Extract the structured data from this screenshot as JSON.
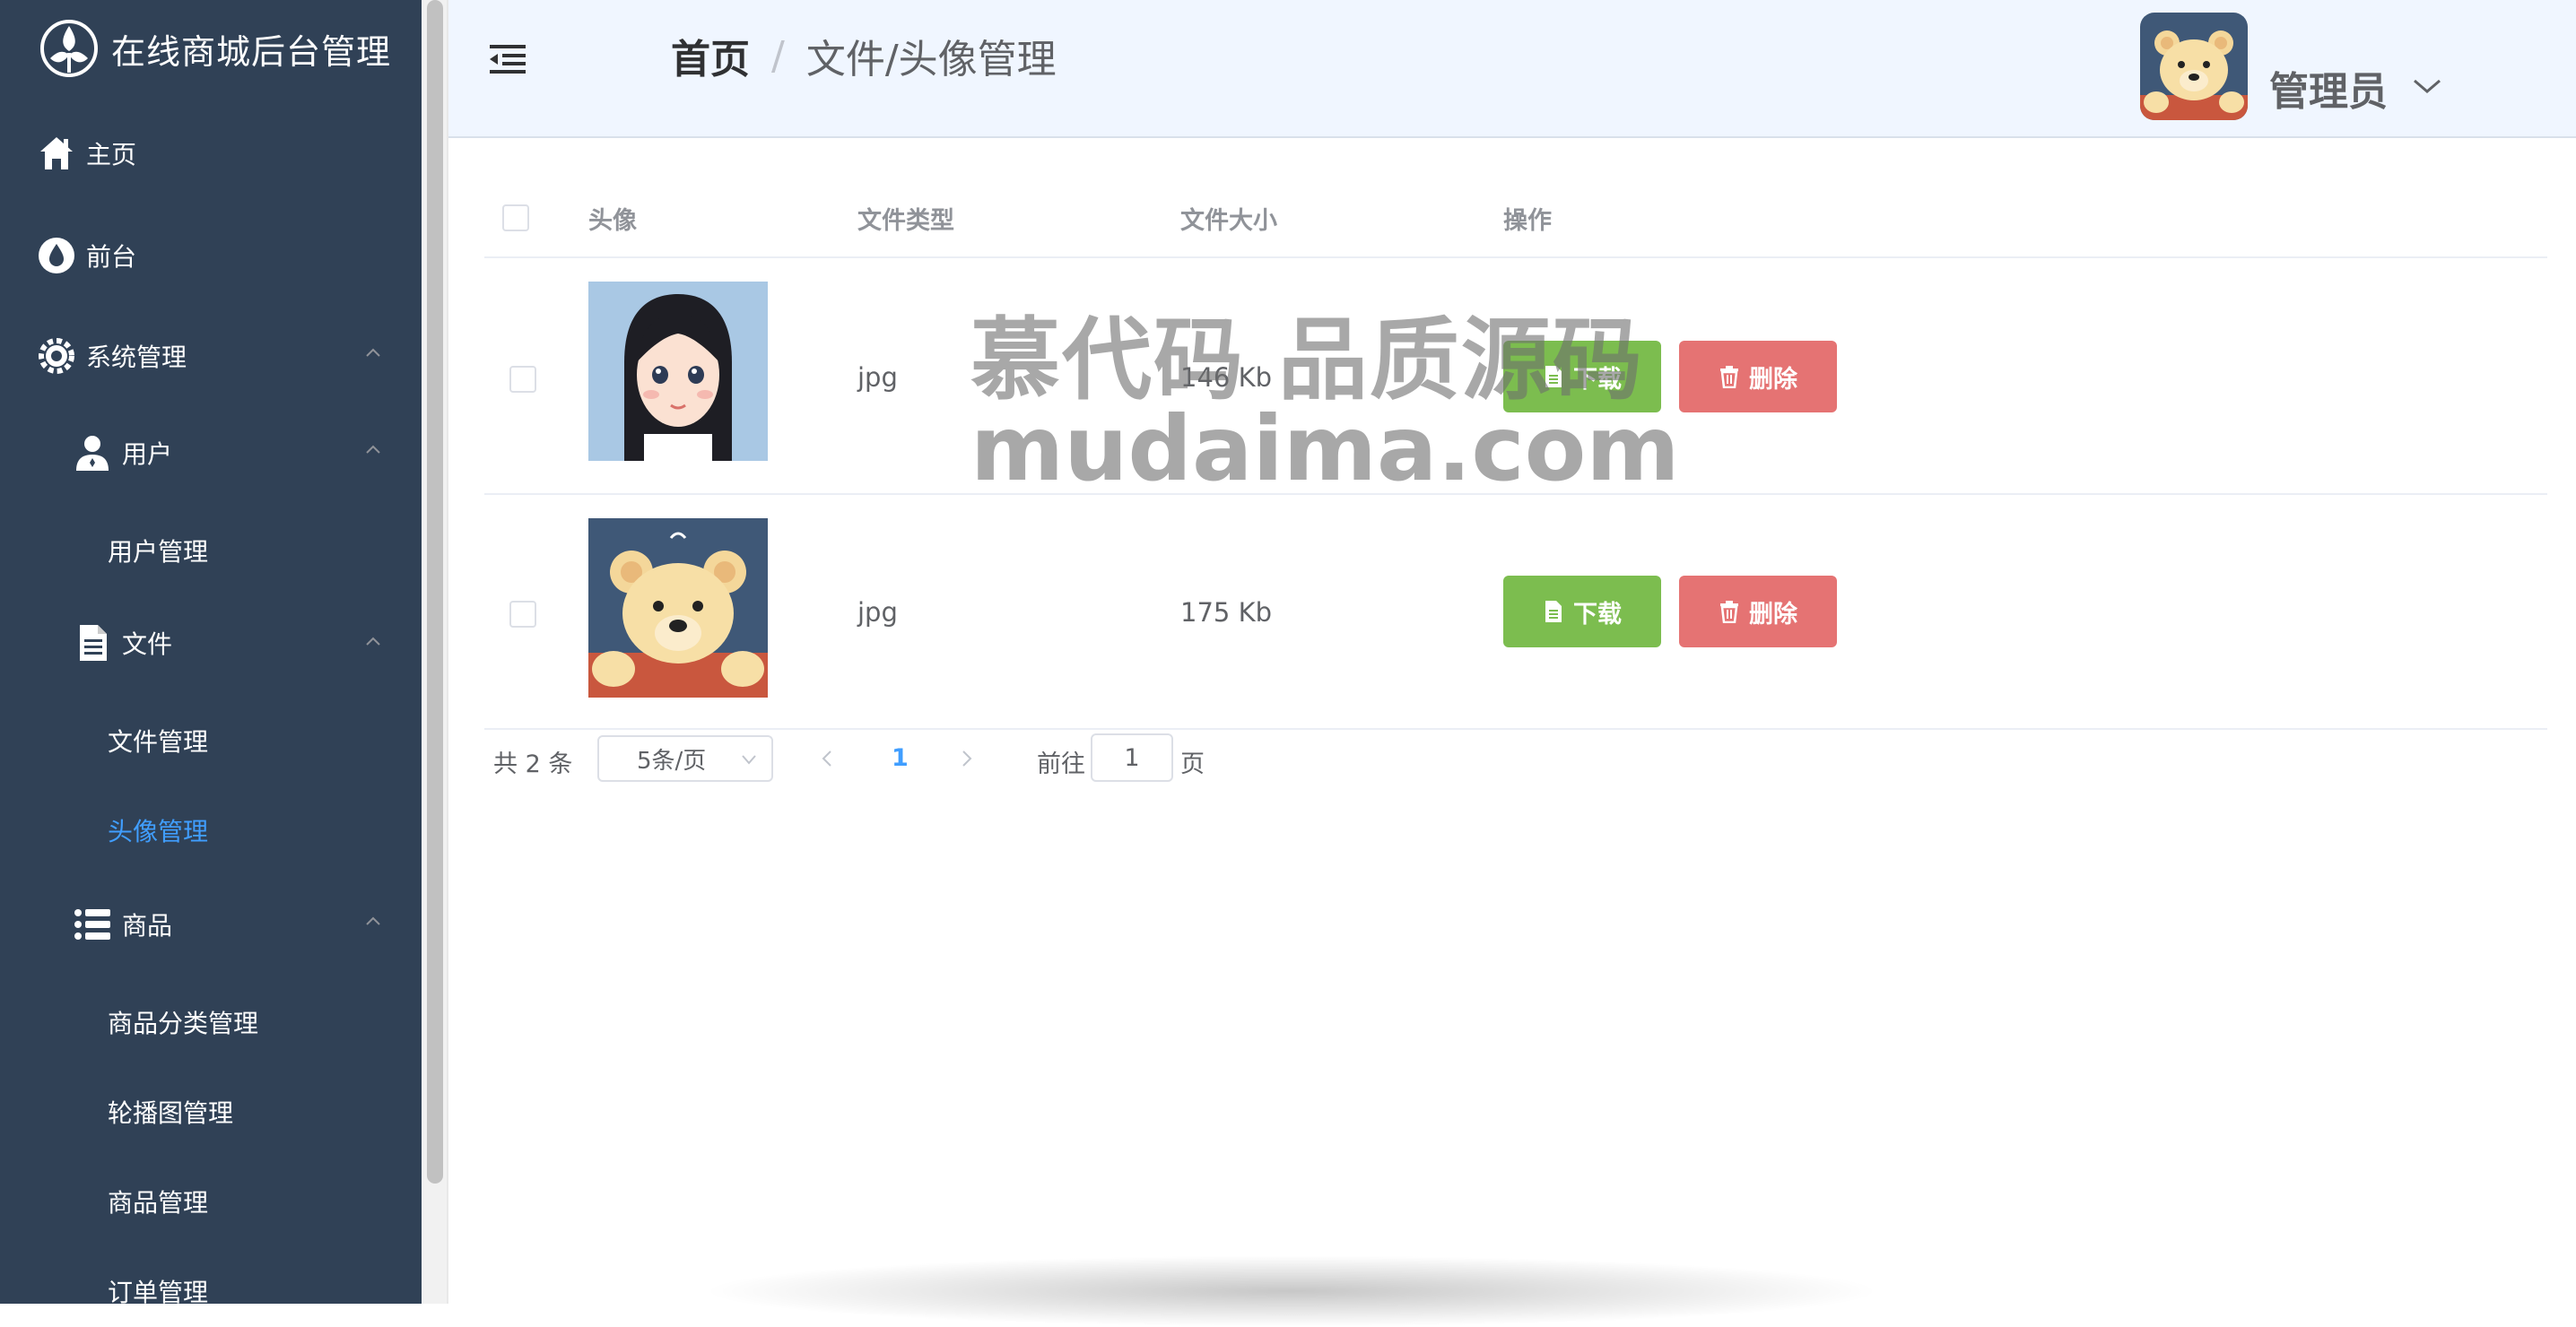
{
  "app": {
    "title": "在线商城后台管理"
  },
  "sidebar": {
    "items": [
      {
        "label": "主页",
        "icon": "home-icon"
      },
      {
        "label": "前台",
        "icon": "drop-icon"
      },
      {
        "label": "系统管理",
        "icon": "gear-icon"
      },
      {
        "label": "用户",
        "icon": "user-icon"
      },
      {
        "label": "用户管理"
      },
      {
        "label": "文件",
        "icon": "document-icon"
      },
      {
        "label": "文件管理"
      },
      {
        "label": "头像管理",
        "active": true
      },
      {
        "label": "商品",
        "icon": "list-icon"
      },
      {
        "label": "商品分类管理"
      },
      {
        "label": "轮播图管理"
      },
      {
        "label": "商品管理"
      },
      {
        "label": "订单管理"
      }
    ]
  },
  "header": {
    "breadcrumb": {
      "home": "首页",
      "separator": "/",
      "current": "文件/头像管理"
    },
    "user": {
      "name": "管理员"
    }
  },
  "table": {
    "columns": [
      "头像",
      "文件类型",
      "文件大小",
      "操作"
    ],
    "rows": [
      {
        "avatar": "girl-avatar",
        "type": "jpg",
        "size": "146 Kb"
      },
      {
        "avatar": "bear-avatar",
        "type": "jpg",
        "size": "175 Kb"
      }
    ],
    "actions": {
      "download": "下载",
      "delete": "删除"
    }
  },
  "pagination": {
    "total": "共 2 条",
    "page_size": "5条/页",
    "current_page": "1",
    "goto_label": "前往",
    "goto_value": "1",
    "page_suffix": "页"
  },
  "watermark": {
    "line1": "慕代码 品质源码",
    "line2": "mudaima.com"
  },
  "colors": {
    "sidebar_bg": "#304156",
    "active": "#409eff",
    "download": "#7cbd4f",
    "delete": "#e57373",
    "header_bg": "#f0f6ff"
  }
}
